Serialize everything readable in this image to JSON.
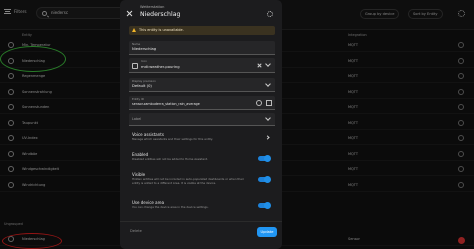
{
  "toolbar": {
    "filters_label": "Filters",
    "search_value": "niedersc",
    "group_by": "Group by device",
    "sort_by": "Sort by Entity"
  },
  "table": {
    "headers": {
      "entity": "Entity",
      "integration": "Integration"
    },
    "rows": [
      {
        "name": "Min. Temperatur",
        "integration": "MQTT"
      },
      {
        "name": "Niederschlag",
        "integration": "MQTT"
      },
      {
        "name": "Regenmenge",
        "integration": "MQTT"
      },
      {
        "name": "Sonnenstrahlung",
        "integration": "MQTT"
      },
      {
        "name": "Sonnenstunden",
        "integration": "MQTT"
      },
      {
        "name": "Taupunkt",
        "integration": "MQTT"
      },
      {
        "name": "UV-Index",
        "integration": "MQTT"
      },
      {
        "name": "Windböe",
        "integration": "MQTT"
      },
      {
        "name": "Windgeschwindigkeit",
        "integration": "MQTT"
      },
      {
        "name": "Windrichtung",
        "integration": "MQTT"
      }
    ],
    "group_label": "Ungrouped",
    "ungrouped_row": {
      "name": "Niederschlag",
      "integration": "Sensor"
    }
  },
  "dialog": {
    "subtitle": "Wetterstation",
    "title": "Niederschlag",
    "warning": "This entity is unavailable.",
    "name_field": {
      "label": "Name",
      "value": "Niederschlag"
    },
    "icon_field": {
      "label": "Icon",
      "value": "mdi:weather-pouring"
    },
    "display_precision": {
      "label": "Display precision",
      "value": "Default (0)"
    },
    "entity_id": {
      "label": "Entity ID",
      "value": "sensor.zambuderra_station_rain_average"
    },
    "area": {
      "label": "Label",
      "value": ""
    },
    "voice": {
      "title": "Voice assistants",
      "desc": "Manage which assistants and their settings for this entity."
    },
    "enabled": {
      "title": "Enabled",
      "desc": "Disabled entities will not be added to Home Assistant."
    },
    "visible": {
      "title": "Visible",
      "desc": "Hidden entities will not be included in auto-populated dashboards or when their entity is added to a different Area. It is visible at the device."
    },
    "device_area": {
      "title": "Use device area",
      "desc": "You can change the device area in the device settings."
    },
    "delete_label": "Delete",
    "update_label": "Update"
  },
  "colors": {
    "accent": "#2196f3",
    "warning": "#f0b429",
    "green_mark": "#3fbf3f",
    "red_mark": "#e02020"
  }
}
